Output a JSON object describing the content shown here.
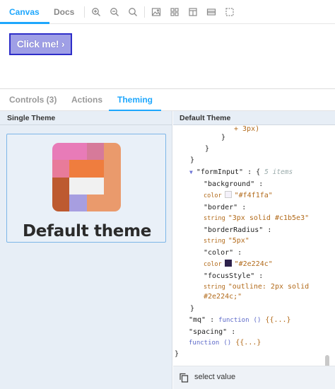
{
  "toolbar": {
    "tabs": [
      {
        "label": "Canvas",
        "active": true
      },
      {
        "label": "Docs",
        "active": false
      }
    ],
    "tools": [
      "zoom-in-icon",
      "zoom-out-icon",
      "zoom-reset-icon",
      "background-icon",
      "grid-icon",
      "viewport-icon",
      "measure-icon",
      "outline-icon"
    ]
  },
  "canvas": {
    "button_label": "Click me! ›"
  },
  "addons": {
    "tabs": [
      {
        "label": "Controls (3)"
      },
      {
        "label": "Actions"
      },
      {
        "label": "Theming"
      }
    ]
  },
  "left": {
    "header": "Single Theme",
    "theme_name": "Default theme"
  },
  "right": {
    "header": "Default Theme",
    "lines": {
      "l0": "+ 3px)",
      "l1": "}",
      "l2": "}",
      "l3": "}",
      "formInput_key": "\"formInput\"",
      "formInput_meta": "5 items",
      "bg_key": "\"background\"",
      "bg_type": "color",
      "bg_val": "\"#f4f1fa\"",
      "border_key": "\"border\"",
      "border_type": "string",
      "border_val": "\"3px solid #c1b5e3\"",
      "radius_key": "\"borderRadius\"",
      "radius_type": "string",
      "radius_val": "\"5px\"",
      "color_key": "\"color\"",
      "color_type": "color",
      "color_val": "\"#2e224c\"",
      "focus_key": "\"focusStyle\"",
      "focus_type": "string",
      "focus_val1": "\"outline: 2px solid",
      "focus_val2": "#2e224c;\"",
      "close1": "}",
      "mq_key": "\"mq\"",
      "mq_type": "function",
      "mq_sig": "()",
      "spacing_key": "\"spacing\"",
      "spacing_type": "function",
      "spacing_sig": "()",
      "body_dots": "{{...}",
      "close_root": "}"
    },
    "footer_label": "select value"
  },
  "colors": {
    "accent": "#1ea7fd",
    "bg_swatch": "#f4f1fa",
    "color_swatch": "#2e224c"
  }
}
